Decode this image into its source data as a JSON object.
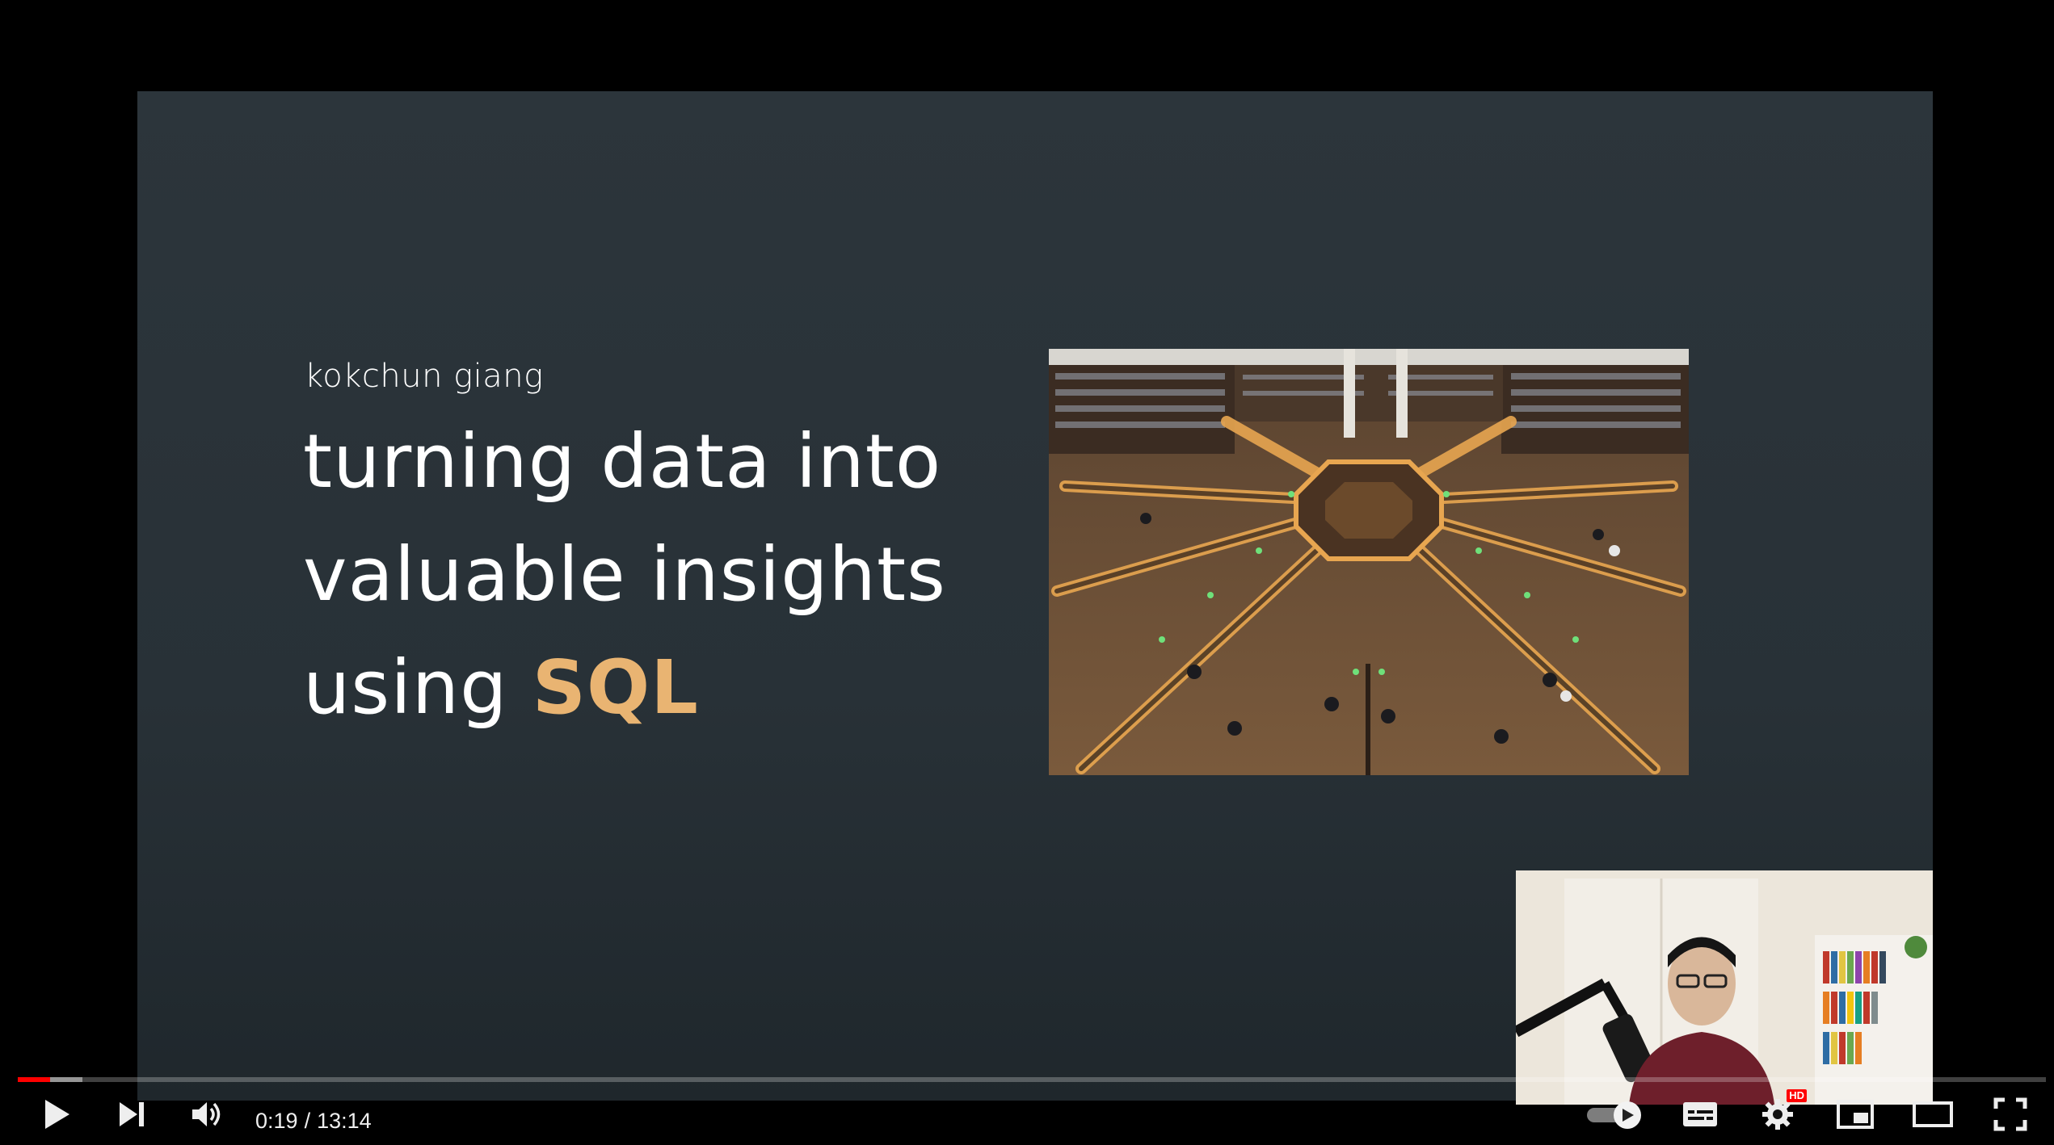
{
  "slide": {
    "author": "kokchun giang",
    "title_line1": "turning data into",
    "title_line2": "valuable insights",
    "title_line3_prefix": "using ",
    "title_line3_highlight": "SQL",
    "accent_color": "#e9b472"
  },
  "player": {
    "current_time": "0:19",
    "separator": "/",
    "duration": "13:14",
    "progress_played_fraction": 0.016,
    "progress_buffered_fraction": 0.032,
    "quality_badge": "HD",
    "progress_color": "#ff0000",
    "icons": [
      "play-icon",
      "next-icon",
      "volume-icon",
      "autoplay-toggle-icon",
      "subtitles-icon",
      "settings-icon",
      "miniplayer-icon",
      "theater-mode-icon",
      "fullscreen-icon"
    ]
  }
}
